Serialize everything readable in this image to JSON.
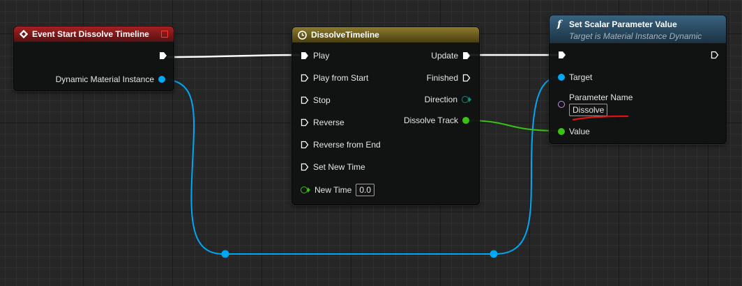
{
  "nodes": {
    "event": {
      "title": "Event Start Dissolve Timeline",
      "output": "Dynamic Material Instance"
    },
    "timeline": {
      "title": "DissolveTimeline",
      "inputs": [
        "Play",
        "Play from Start",
        "Stop",
        "Reverse",
        "Reverse from End",
        "Set New Time",
        "New Time"
      ],
      "new_time_value": "0.0",
      "outputs": [
        "Update",
        "Finished",
        "Direction",
        "Dissolve Track"
      ]
    },
    "setter": {
      "title": "Set Scalar Parameter Value",
      "subtitle": "Target is Material Instance Dynamic",
      "target_label": "Target",
      "param_label": "Parameter Name",
      "param_value": "Dissolve",
      "value_label": "Value"
    }
  },
  "colors": {
    "exec_pin": "#ffffff",
    "object_pin": "#00a8f4",
    "float_pin": "#39c312",
    "name_pin": "#c88bec",
    "event_header": "#a52121",
    "timeline_header": "#8c7a2c",
    "function_header": "#39637f",
    "annotation": "#e01414"
  }
}
